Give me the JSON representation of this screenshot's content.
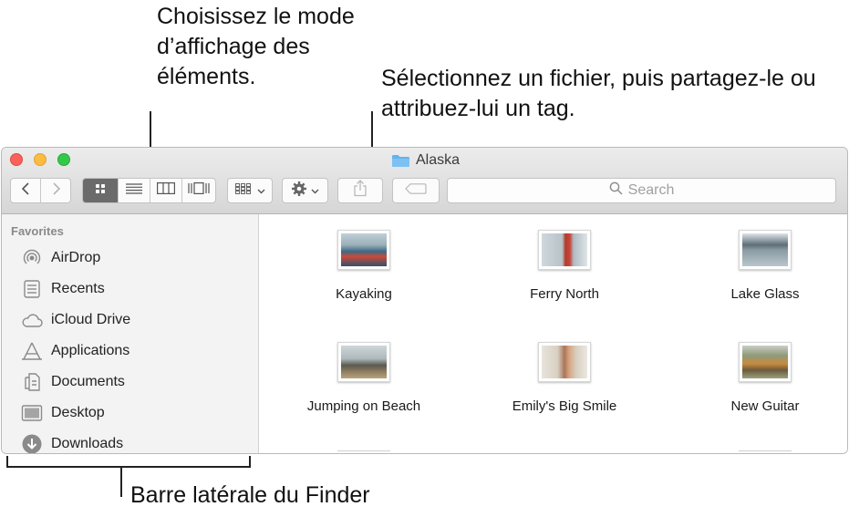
{
  "callouts": {
    "view_mode": "Choisissez le mode d’affichage des éléments.",
    "share_tag": "Sélectionnez un fichier, puis partagez-le ou attribuez-lui un tag.",
    "sidebar": "Barre latérale du Finder"
  },
  "window": {
    "title": "Alaska",
    "accent_color": "#5a5a5a",
    "folder_color": "#63b3ee"
  },
  "toolbar": {
    "back_icon": "chevron-left-icon",
    "forward_icon": "chevron-right-icon",
    "view_modes": [
      "icon-view-icon",
      "list-view-icon",
      "column-view-icon",
      "cover-flow-icon"
    ],
    "selected_view": "icon-view-icon",
    "arrange_icon": "group-icon",
    "action_icon": "gear-icon",
    "share_icon": "share-icon",
    "tag_icon": "tag-icon",
    "search_placeholder": "Search"
  },
  "sidebar": {
    "heading": "Favorites",
    "items": [
      {
        "label": "AirDrop",
        "icon": "airdrop-icon"
      },
      {
        "label": "Recents",
        "icon": "recents-icon"
      },
      {
        "label": "iCloud Drive",
        "icon": "cloud-icon"
      },
      {
        "label": "Applications",
        "icon": "applications-icon"
      },
      {
        "label": "Documents",
        "icon": "documents-icon"
      },
      {
        "label": "Desktop",
        "icon": "desktop-icon"
      },
      {
        "label": "Downloads",
        "icon": "downloads-icon"
      }
    ]
  },
  "files": [
    {
      "name": "Kayaking"
    },
    {
      "name": "Ferry North"
    },
    {
      "name": "Lake Glass"
    },
    {
      "name": "Jumping on Beach"
    },
    {
      "name": "Emily's Big Smile"
    },
    {
      "name": "New Guitar"
    }
  ]
}
